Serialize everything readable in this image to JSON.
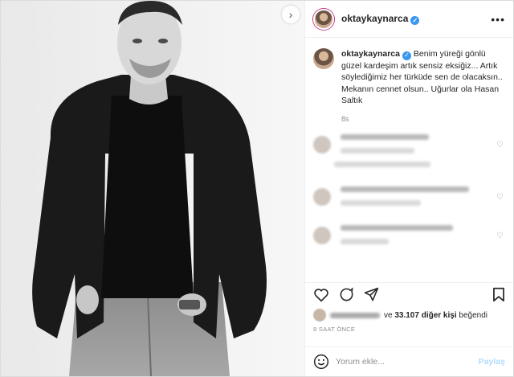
{
  "header": {
    "username": "oktaykaynarca",
    "verified_icon": "verified-badge-icon",
    "more_icon": "more-options-icon"
  },
  "caption": {
    "username": "oktaykaynarca",
    "text": "Benim yüreği gönlü güzel kardeşim artık sensiz eksiğiz... Artık söylediğimiz her türküde sen de olacaksın.. Mekanın cennet olsun.. Uğurlar ola Hasan Saltık",
    "time_ago": "8s"
  },
  "comments": [
    {
      "blurred": true
    },
    {
      "blurred": true
    },
    {
      "blurred": true
    }
  ],
  "actions": {
    "like_icon": "heart-icon",
    "comment_icon": "comment-icon",
    "share_icon": "share-icon",
    "save_icon": "bookmark-icon"
  },
  "likes": {
    "prefix": "ve",
    "count_text": "33.107 diğer kişi",
    "suffix": "beğendi"
  },
  "timestamp": "8 SAAT ÖNCE",
  "add_comment": {
    "placeholder": "Yorum ekle...",
    "post_label": "Paylaş",
    "emoji_icon": "emoji-icon"
  },
  "colors": {
    "verified": "#3897f0",
    "text": "#262626",
    "muted": "#8e8e8e",
    "post_disabled": "#b3dbff"
  }
}
